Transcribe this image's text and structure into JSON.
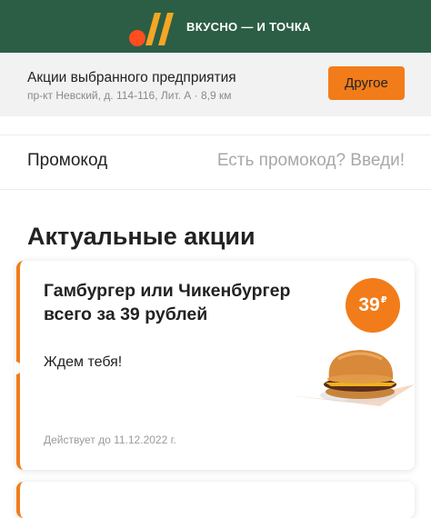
{
  "header": {
    "brand_name": "ВКУСНО — И ТОЧКА",
    "background_color": "#2b5e45"
  },
  "store": {
    "title": "Акции выбранного предприятия",
    "address": "пр-кт Невский, д. 114-116, Лит. А · 8,9 км",
    "other_button_label": "Другое",
    "accent_color": "#f27c1a"
  },
  "promo": {
    "label": "Промокод",
    "placeholder": "Есть промокод? Введи!"
  },
  "offers_section": {
    "title": "Актуальные акции",
    "offers": [
      {
        "title": "Гамбургер или Чикенбургер всего за 39 рублей",
        "subtitle": "Ждем тебя!",
        "price": "39",
        "currency": "₽",
        "validity": "Действует до 11.12.2022 г.",
        "image": "burger-image"
      }
    ]
  }
}
